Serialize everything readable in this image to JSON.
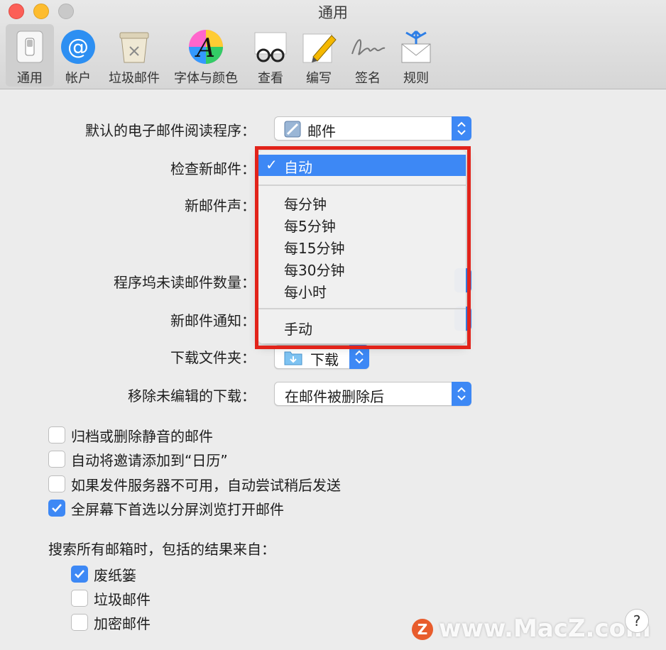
{
  "window": {
    "title": "通用"
  },
  "toolbar": [
    {
      "label": "通用",
      "icon": "general-switch-icon",
      "active": true
    },
    {
      "label": "帐户",
      "icon": "at-sign-icon"
    },
    {
      "label": "垃圾邮件",
      "icon": "junk-bin-icon"
    },
    {
      "label": "字体与颜色",
      "icon": "font-color-icon"
    },
    {
      "label": "查看",
      "icon": "glasses-icon"
    },
    {
      "label": "编写",
      "icon": "pencil-icon"
    },
    {
      "label": "签名",
      "icon": "signature-icon"
    },
    {
      "label": "规则",
      "icon": "rules-envelope-icon"
    }
  ],
  "form": {
    "default_reader_label": "默认的电子邮件阅读程序：",
    "default_reader_value": "邮件",
    "check_mail_label": "检查新邮件：",
    "new_mail_sound_label": "新邮件声：",
    "dock_unread_label": "程序坞未读邮件数量：",
    "notify_label": "新邮件通知：",
    "download_folder_label": "下载文件夹：",
    "download_folder_value": "下载",
    "remove_downloads_label": "移除未编辑的下载：",
    "remove_downloads_value": "在邮件被删除后"
  },
  "menu": {
    "selected": "自动",
    "checkmark": "✓",
    "items": [
      "每分钟",
      "每5分钟",
      "每15分钟",
      "每30分钟",
      "每小时"
    ],
    "last": "手动"
  },
  "options": [
    {
      "label": "归档或删除静音的邮件",
      "checked": false
    },
    {
      "label": "自动将邀请添加到“日历”",
      "checked": false
    },
    {
      "label": "如果发件服务器不可用，自动尝试稍后发送",
      "checked": false
    },
    {
      "label": "全屏幕下首选以分屏浏览打开邮件",
      "checked": true
    }
  ],
  "search": {
    "heading": "搜索所有邮箱时，包括的结果来自：",
    "items": [
      {
        "label": "废纸篓",
        "checked": true
      },
      {
        "label": "垃圾邮件",
        "checked": false
      },
      {
        "label": "加密邮件",
        "checked": false
      }
    ]
  },
  "help": "?",
  "watermark": "www.MacZ.com",
  "watermark_logo": "Z",
  "colors": {
    "accent": "#3d88f5",
    "highlight": "#e2231a"
  }
}
